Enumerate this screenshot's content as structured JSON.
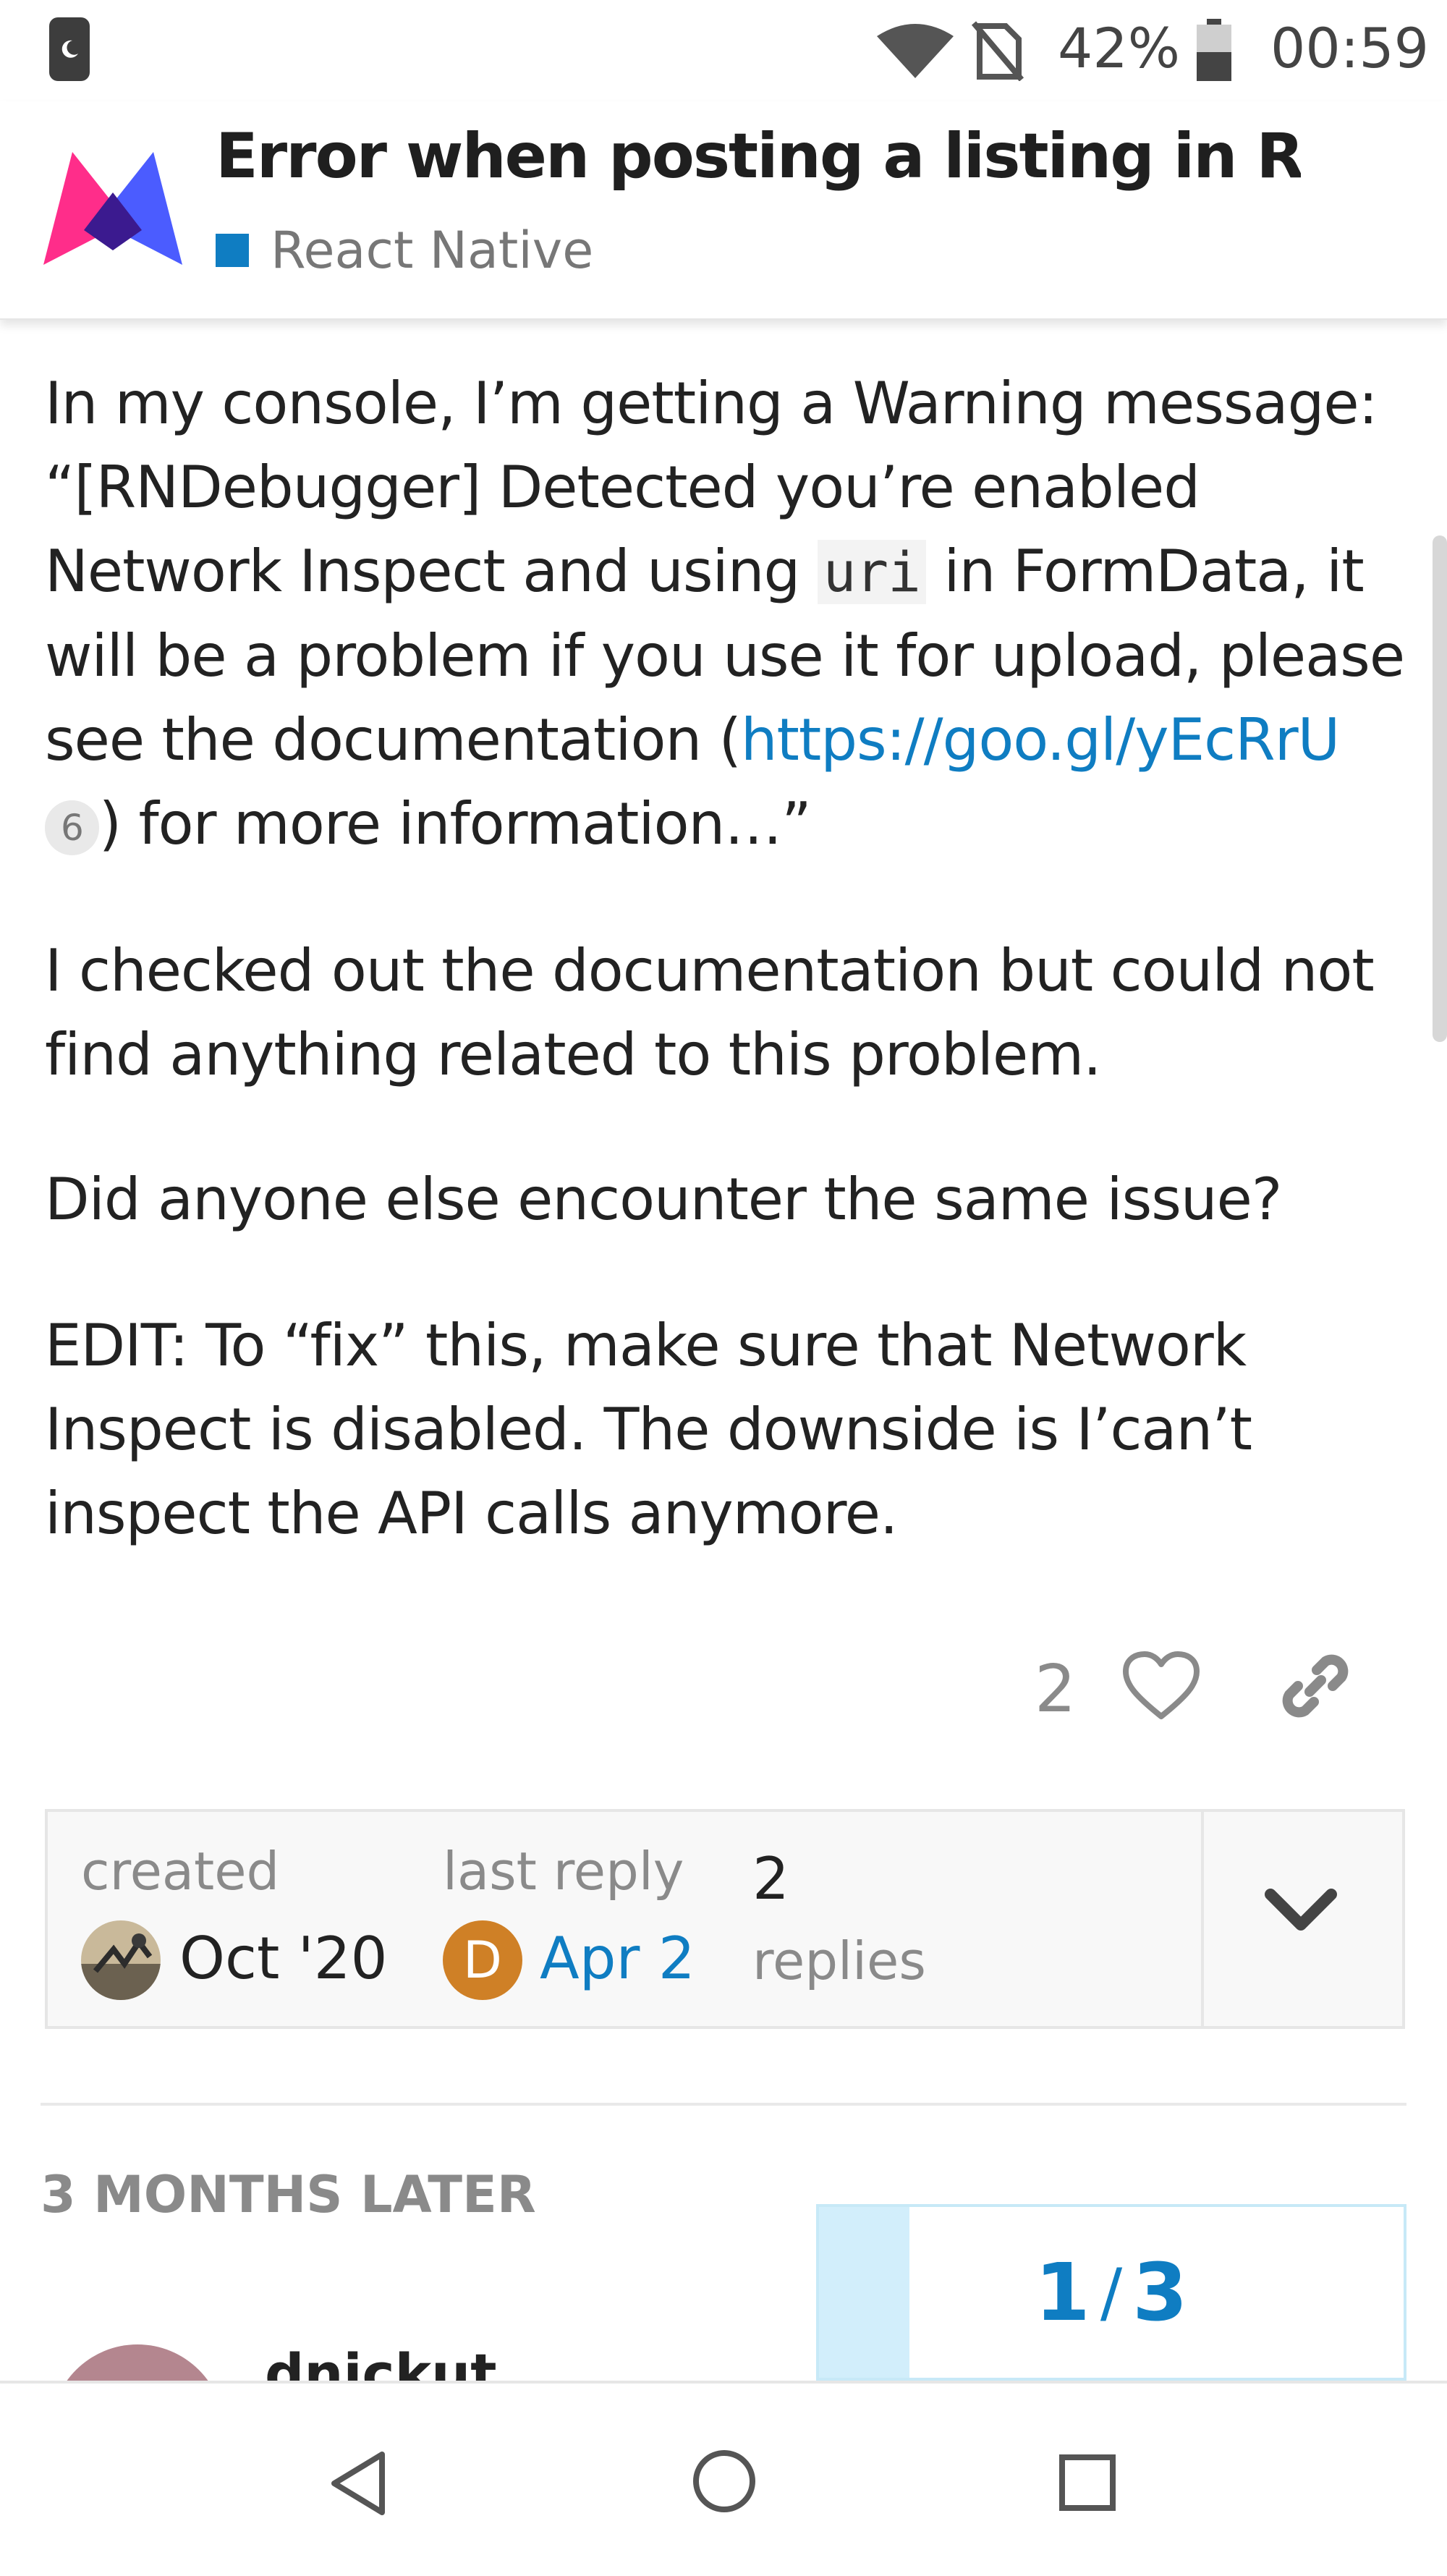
{
  "status_bar": {
    "battery_percent": "42%",
    "time": "00:59",
    "icons": [
      "moon-icon",
      "wifi-icon",
      "no-sim-icon",
      "battery-icon"
    ]
  },
  "header": {
    "title": "Error when posting a listing in Re…",
    "category": "React Native",
    "category_color": "#0f7dc2"
  },
  "post": {
    "p1": {
      "before_code": "In my console, I’m getting a Warning message: “[RNDebugger] Detected you’re enabled Network Inspect and using ",
      "code": "uri",
      "after_code": " in FormData, it will be a problem if you use it for upload, please see the documentation (",
      "link": "https://goo.gl/yEcRrU",
      "link_clicks": "6",
      "after_link": ") for more information…”"
    },
    "p2": "I checked out the documentation but could not find anything related to this problem.",
    "p3": "Did anyone else encounter the same issue?",
    "p4": "EDIT: To “fix” this, make sure that Network Inspect is disabled. The downside is I’can’t inspect the API calls anymore.",
    "like_count": "2"
  },
  "topic_map": {
    "created_label": "created",
    "created_date": "Oct '20",
    "last_reply_label": "last reply",
    "last_reply_avatar_letter": "D",
    "last_reply_date": "Apr 2",
    "replies_count": "2",
    "replies_label": "replies"
  },
  "timeline": {
    "gap_label": "3 MONTHS LATER",
    "next_username": "dnickut",
    "progress_current": "1",
    "progress_total": "3",
    "progress_fraction": 0.155
  },
  "colors": {
    "accent": "#0f7dc2",
    "avatar_d": "#cf8026",
    "progress_fill": "#d2eefb"
  }
}
